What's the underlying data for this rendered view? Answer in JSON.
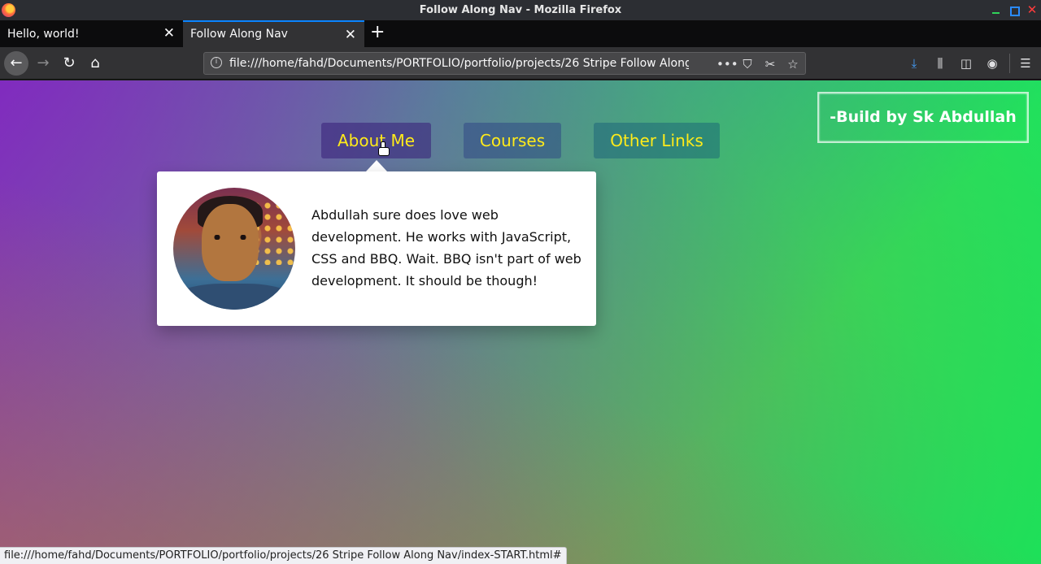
{
  "window": {
    "title": "Follow Along Nav - Mozilla Firefox"
  },
  "tabs": [
    {
      "label": "Hello, world!",
      "active": false
    },
    {
      "label": "Follow Along Nav",
      "active": true
    }
  ],
  "toolbar": {
    "url": "file:///home/fahd/Documents/PORTFOLIO/portfolio/projects/26 Stripe Follow Along Nav/index-START.html",
    "more_glyph": "•••"
  },
  "page": {
    "nav": [
      {
        "label": "About Me"
      },
      {
        "label": "Courses"
      },
      {
        "label": "Other Links"
      }
    ],
    "credit": "-Build by Sk Abdullah",
    "dropdown": {
      "bio": "Abdullah sure does love web development. He works with JavaScript, CSS and BBQ. Wait. BBQ isn't part of web development. It should be though!"
    },
    "colors": {
      "nav_text": "#ffeb1a",
      "gradient_start": "#f21f6a",
      "gradient_end": "#2bde55"
    }
  },
  "statusbar": {
    "text": "file:///home/fahd/Documents/PORTFOLIO/portfolio/projects/26 Stripe Follow Along Nav/index-START.html#"
  }
}
